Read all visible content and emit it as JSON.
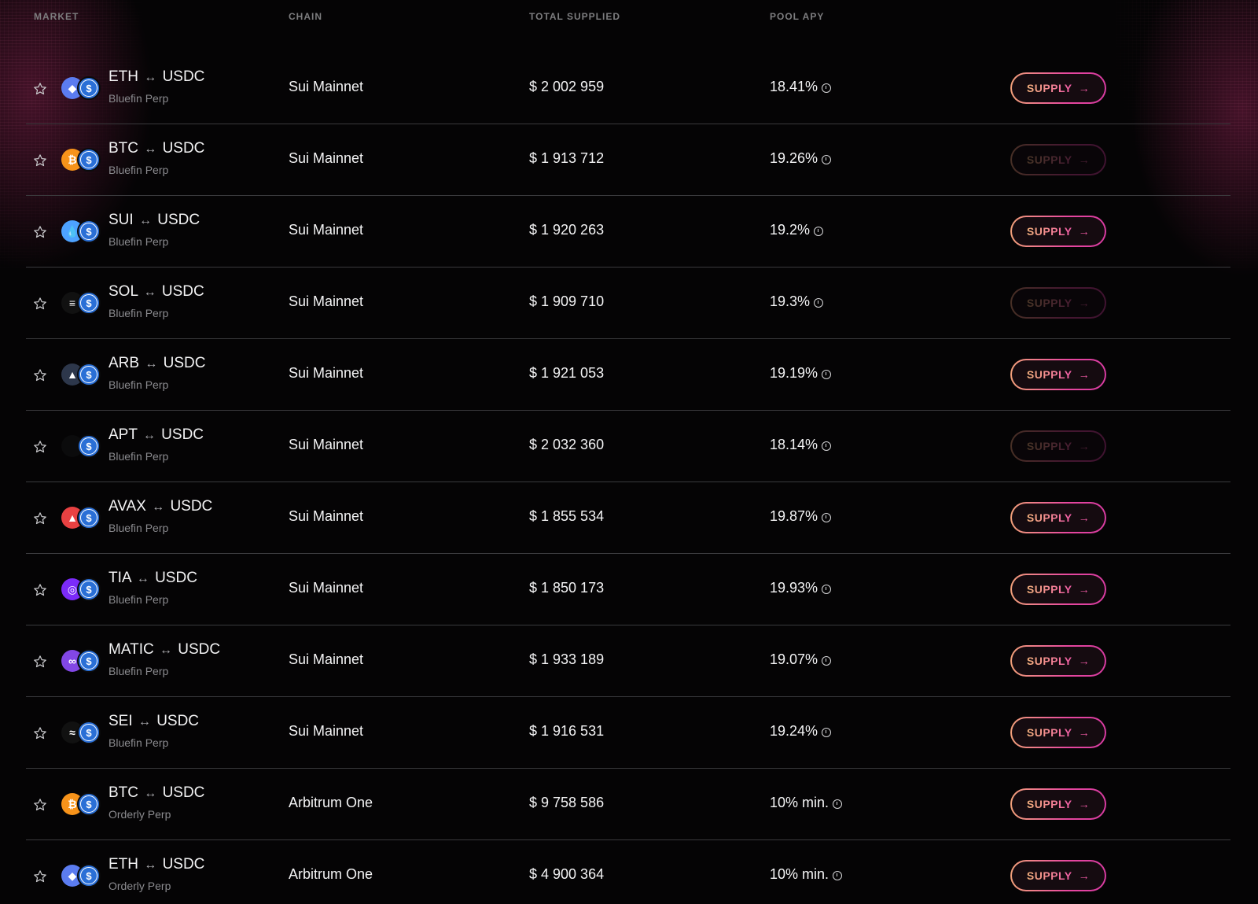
{
  "header": {
    "market": "MARKET",
    "chain": "CHAIN",
    "total_supplied": "TOTAL SUPPLIED",
    "pool_apy": "POOL APY"
  },
  "colors": {
    "accent_start": "#f5b27e",
    "accent_end": "#f05aa6",
    "usdc_blue": "#2a6fd6",
    "row_divider": "#3a3a3d"
  },
  "rows": [
    {
      "base": "ETH",
      "arrow": "↔",
      "quote": "USDC",
      "venue": "Bluefin Perp",
      "chain": "Sui Mainnet",
      "supplied": "$ 2 002 959",
      "apy": "18.41%",
      "button": "SUPPLY",
      "enabled": true,
      "base_icon": "eth-icon",
      "base_color": "#5b7cf0"
    },
    {
      "base": "BTC",
      "arrow": "↔",
      "quote": "USDC",
      "venue": "Bluefin Perp",
      "chain": "Sui Mainnet",
      "supplied": "$ 1 913 712",
      "apy": "19.26%",
      "button": "SUPPLY",
      "enabled": false,
      "base_icon": "btc-icon",
      "base_color": "#f7931a"
    },
    {
      "base": "SUI",
      "arrow": "↔",
      "quote": "USDC",
      "venue": "Bluefin Perp",
      "chain": "Sui Mainnet",
      "supplied": "$ 1 920 263",
      "apy": "19.2%",
      "button": "SUPPLY",
      "enabled": true,
      "base_icon": "sui-icon",
      "base_color": "#4da2ff"
    },
    {
      "base": "SOL",
      "arrow": "↔",
      "quote": "USDC",
      "venue": "Bluefin Perp",
      "chain": "Sui Mainnet",
      "supplied": "$ 1 909 710",
      "apy": "19.3%",
      "button": "SUPPLY",
      "enabled": false,
      "base_icon": "sol-icon",
      "base_color": "#111111"
    },
    {
      "base": "ARB",
      "arrow": "↔",
      "quote": "USDC",
      "venue": "Bluefin Perp",
      "chain": "Sui Mainnet",
      "supplied": "$ 1 921 053",
      "apy": "19.19%",
      "button": "SUPPLY",
      "enabled": true,
      "base_icon": "arb-icon",
      "base_color": "#2d374b"
    },
    {
      "base": "APT",
      "arrow": "↔",
      "quote": "USDC",
      "venue": "Bluefin Perp",
      "chain": "Sui Mainnet",
      "supplied": "$ 2 032 360",
      "apy": "18.14%",
      "button": "SUPPLY",
      "enabled": false,
      "base_icon": "apt-icon",
      "base_color": "#0b0b0c"
    },
    {
      "base": "AVAX",
      "arrow": "↔",
      "quote": "USDC",
      "venue": "Bluefin Perp",
      "chain": "Sui Mainnet",
      "supplied": "$ 1 855 534",
      "apy": "19.87%",
      "button": "SUPPLY",
      "enabled": true,
      "base_icon": "avax-icon",
      "base_color": "#e84142"
    },
    {
      "base": "TIA",
      "arrow": "↔",
      "quote": "USDC",
      "venue": "Bluefin Perp",
      "chain": "Sui Mainnet",
      "supplied": "$ 1 850 173",
      "apy": "19.93%",
      "button": "SUPPLY",
      "enabled": true,
      "base_icon": "tia-icon",
      "base_color": "#7b2bf9"
    },
    {
      "base": "MATIC",
      "arrow": "↔",
      "quote": "USDC",
      "venue": "Bluefin Perp",
      "chain": "Sui Mainnet",
      "supplied": "$ 1 933 189",
      "apy": "19.07%",
      "button": "SUPPLY",
      "enabled": true,
      "base_icon": "matic-icon",
      "base_color": "#8247e5"
    },
    {
      "base": "SEI",
      "arrow": "↔",
      "quote": "USDC",
      "venue": "Bluefin Perp",
      "chain": "Sui Mainnet",
      "supplied": "$ 1 916 531",
      "apy": "19.24%",
      "button": "SUPPLY",
      "enabled": true,
      "base_icon": "sei-icon",
      "base_color": "#111111"
    },
    {
      "base": "BTC",
      "arrow": "↔",
      "quote": "USDC",
      "venue": "Orderly Perp",
      "chain": "Arbitrum One",
      "supplied": "$ 9 758 586",
      "apy": "10% min.",
      "button": "SUPPLY",
      "enabled": true,
      "base_icon": "btc-icon",
      "base_color": "#f7931a"
    },
    {
      "base": "ETH",
      "arrow": "↔",
      "quote": "USDC",
      "venue": "Orderly Perp",
      "chain": "Arbitrum One",
      "supplied": "$ 4 900 364",
      "apy": "10% min.",
      "button": "SUPPLY",
      "enabled": true,
      "base_icon": "eth-icon",
      "base_color": "#5b7cf0"
    }
  ]
}
